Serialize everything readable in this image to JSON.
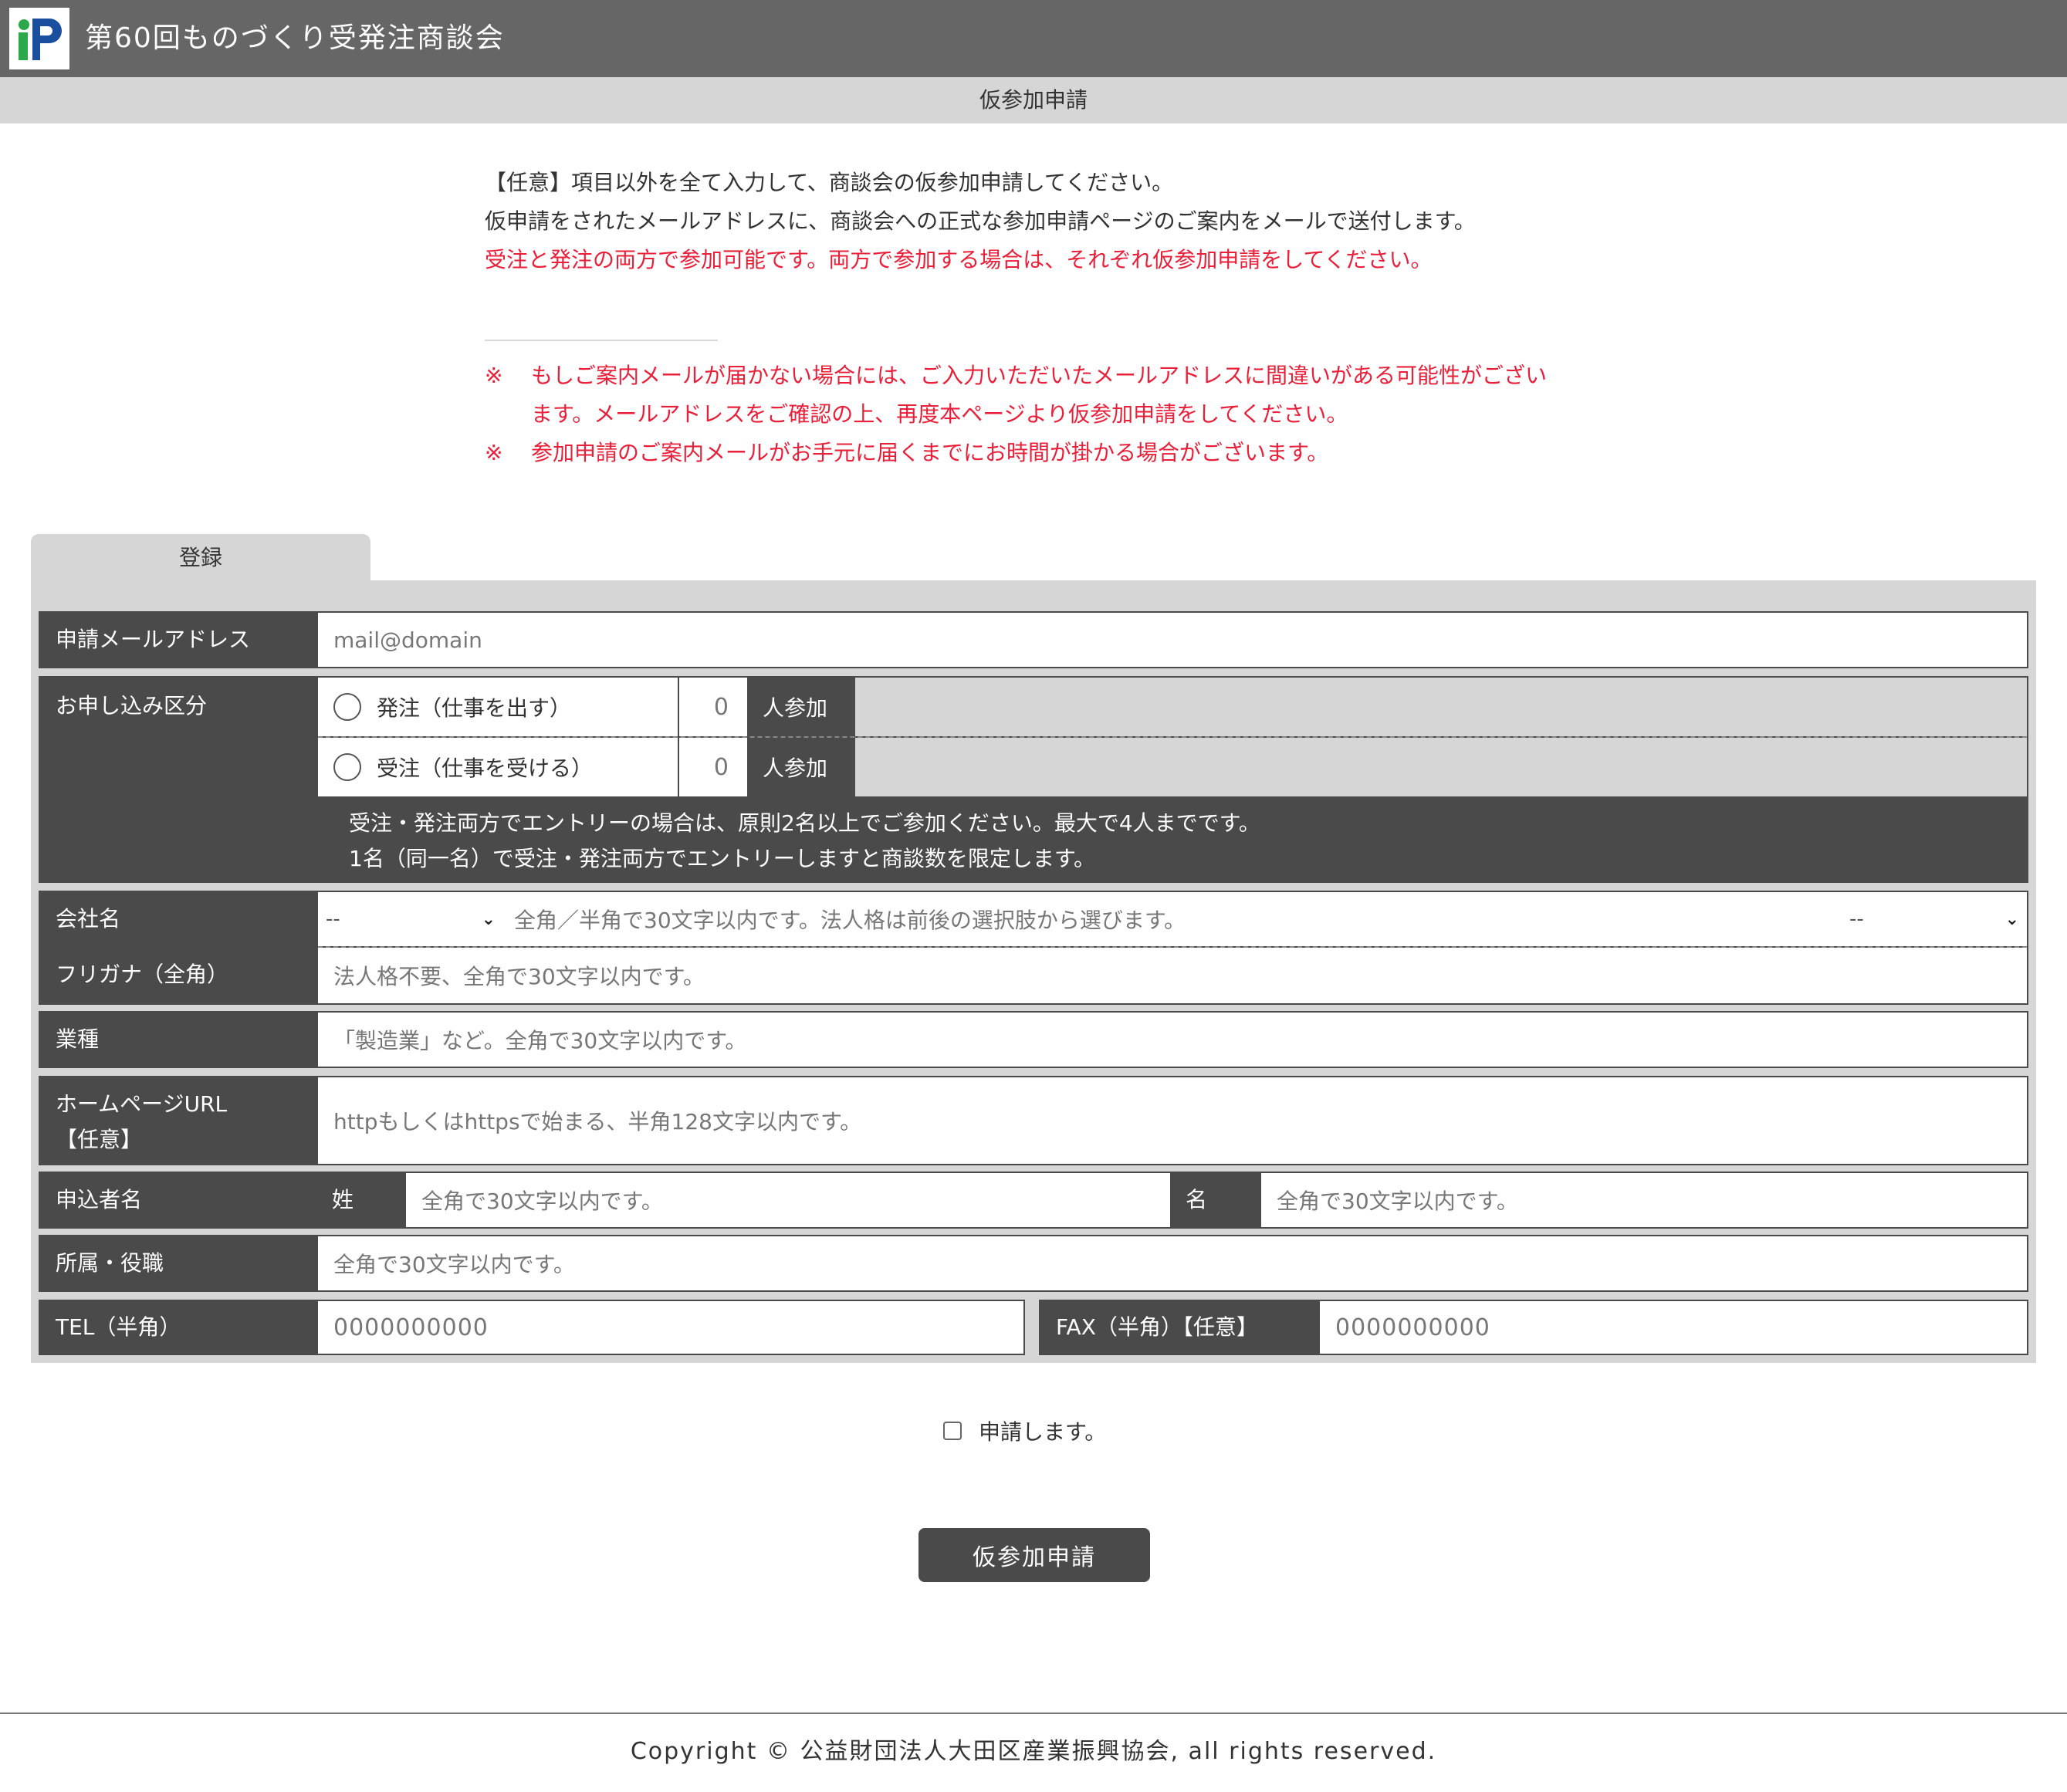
{
  "header": {
    "title": "第60回ものづくり受発注商談会",
    "logo_icon": "ip-logo-icon",
    "bg_color": "#666666"
  },
  "subheader": {
    "title": "仮参加申請"
  },
  "intro": {
    "line1": "【任意】項目以外を全て入力して、商談会の仮参加申請してください。",
    "line2": "仮申請をされたメールアドレスに、商談会への正式な参加申請ページのご案内をメールで送付します。",
    "line3": "受注と発注の両方で参加可能です。両方で参加する場合は、それぞれ仮参加申請をしてください。"
  },
  "notes": {
    "mark": "※",
    "note1_line1": "もしご案内メールが届かない場合には、ご入力いただいたメールアドレスに間違いがある可能性がござい",
    "note1_line2": "ます。メールアドレスをご確認の上、再度本ページより仮参加申請をしてください。",
    "note2": "参加申請のご案内メールがお手元に届くまでにお時間が掛かる場合がございます。"
  },
  "tab": {
    "label": "登録"
  },
  "form": {
    "email": {
      "label": "申請メールアドレス",
      "placeholder": "mail@domain"
    },
    "category": {
      "label": "お申し込み区分",
      "order_option": "発注（仕事を出す）",
      "receive_option": "受注（仕事を受ける）",
      "order_count": "0",
      "receive_count": "0",
      "count_suffix": "人参加",
      "note_line1": "受注・発注両方でエントリーの場合は、原則2名以上でご参加ください。最大で4人までです。",
      "note_line2": "1名（同一名）で受注・発注両方でエントリーしますと商談数を限定します。"
    },
    "company": {
      "label": "会社名",
      "prefix_select": "--",
      "placeholder": "全角／半角で30文字以内です。法人格は前後の選択肢から選びます。",
      "suffix_select": "--"
    },
    "furigana": {
      "label": "フリガナ（全角）",
      "placeholder": "法人格不要、全角で30文字以内です。"
    },
    "industry": {
      "label": "業種",
      "placeholder": "「製造業」など。全角で30文字以内です。"
    },
    "homepage": {
      "label_line1": "ホームページURL",
      "label_line2": "【任意】",
      "placeholder": "httpもしくはhttpsで始まる、半角128文字以内です。"
    },
    "applicant": {
      "label": "申込者名",
      "last_label": "姓",
      "last_placeholder": "全角で30文字以内です。",
      "first_label": "名",
      "first_placeholder": "全角で30文字以内です。"
    },
    "department": {
      "label": "所属・役職",
      "placeholder": "全角で30文字以内です。"
    },
    "tel": {
      "label": "TEL（半角）",
      "placeholder": "0000000000"
    },
    "fax": {
      "label": "FAX（半角）【任意】",
      "placeholder": "0000000000"
    }
  },
  "agree": {
    "label": "申請します。"
  },
  "submit": {
    "label": "仮参加申請"
  },
  "footer": {
    "copyright": "Copyright © 公益財団法人大田区産業振興協会, all rights reserved."
  }
}
